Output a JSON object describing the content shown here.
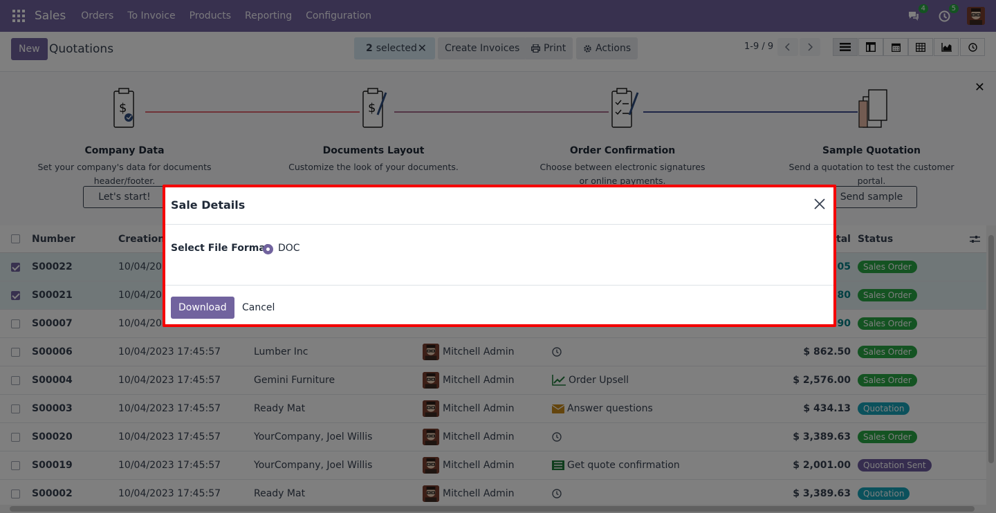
{
  "navbar": {
    "app_name": "Sales",
    "menu": [
      "Orders",
      "To Invoice",
      "Products",
      "Reporting",
      "Configuration"
    ],
    "messages_count": "4",
    "activities_count": "5"
  },
  "control": {
    "new_label": "New",
    "breadcrumb": "Quotations",
    "selected_count": "2",
    "selected_label": "selected",
    "create_invoices": "Create Invoices",
    "print": "Print",
    "actions": "Actions",
    "pager": "1-9 / 9"
  },
  "onboarding": {
    "steps": [
      {
        "title": "Company Data",
        "desc1": "Set your company's data for documents",
        "desc2": "header/footer.",
        "button": "Let's start!"
      },
      {
        "title": "Documents Layout",
        "desc1": "Customize the look of your documents.",
        "desc2": "",
        "button": ""
      },
      {
        "title": "Order Confirmation",
        "desc1": "Choose between electronic signatures",
        "desc2": "or online payments.",
        "button": ""
      },
      {
        "title": "Sample Quotation",
        "desc1": "Send a quotation to test the customer",
        "desc2": "portal.",
        "button": "Send sample"
      }
    ]
  },
  "table": {
    "headers": {
      "number": "Number",
      "creation": "Creation",
      "total": "tal",
      "status": "Status"
    },
    "rows": [
      {
        "number": "S00022",
        "date": "10/04/20",
        "customer": "",
        "salesperson": "",
        "activity": "",
        "activity_icon": "",
        "total": "05",
        "status": "Sales Order",
        "status_color": "green",
        "selected": true
      },
      {
        "number": "S00021",
        "date": "10/04/20",
        "customer": "",
        "salesperson": "",
        "activity": "",
        "activity_icon": "",
        "total": "80",
        "status": "Sales Order",
        "status_color": "green",
        "selected": true
      },
      {
        "number": "S00007",
        "date": "10/04/20",
        "customer": "",
        "salesperson": "",
        "activity": "",
        "activity_icon": "",
        "total": "90",
        "status": "Sales Order",
        "status_color": "green",
        "selected": false
      },
      {
        "number": "S00006",
        "date": "10/04/2023 17:45:57",
        "customer": "Lumber Inc",
        "salesperson": "Mitchell Admin",
        "activity": "",
        "activity_icon": "clock-icon",
        "total": "$ 862.50",
        "status": "Sales Order",
        "status_color": "green",
        "selected": false
      },
      {
        "number": "S00004",
        "date": "10/04/2023 17:45:57",
        "customer": "Gemini Furniture",
        "salesperson": "Mitchell Admin",
        "activity": "Order Upsell",
        "activity_icon": "chart-icon",
        "total": "$ 2,576.00",
        "status": "Sales Order",
        "status_color": "green",
        "selected": false
      },
      {
        "number": "S00003",
        "date": "10/04/2023 17:45:57",
        "customer": "Ready Mat",
        "salesperson": "Mitchell Admin",
        "activity": "Answer questions",
        "activity_icon": "envelope-icon",
        "total": "$ 434.13",
        "status": "Quotation",
        "status_color": "blue",
        "selected": false
      },
      {
        "number": "S00020",
        "date": "10/04/2023 17:45:57",
        "customer": "YourCompany, Joel Willis",
        "salesperson": "Mitchell Admin",
        "activity": "",
        "activity_icon": "clock-icon",
        "total": "$ 3,389.63",
        "status": "Sales Order",
        "status_color": "green",
        "selected": false
      },
      {
        "number": "S00019",
        "date": "10/04/2023 17:45:57",
        "customer": "YourCompany, Joel Willis",
        "salesperson": "Mitchell Admin",
        "activity": "Get quote confirmation",
        "activity_icon": "list-icon",
        "total": "$ 2,001.00",
        "status": "Quotation Sent",
        "status_color": "purple",
        "selected": false
      },
      {
        "number": "S00002",
        "date": "10/04/2023 17:45:57",
        "customer": "Ready Mat",
        "salesperson": "Mitchell Admin",
        "activity": "",
        "activity_icon": "clock-icon",
        "total": "$ 3,389.63",
        "status": "Quotation",
        "status_color": "blue",
        "selected": false
      }
    ]
  },
  "modal": {
    "title": "Sale Details",
    "field_label": "Select File Format",
    "option_label": "DOC",
    "download_label": "Download",
    "cancel_label": "Cancel"
  }
}
